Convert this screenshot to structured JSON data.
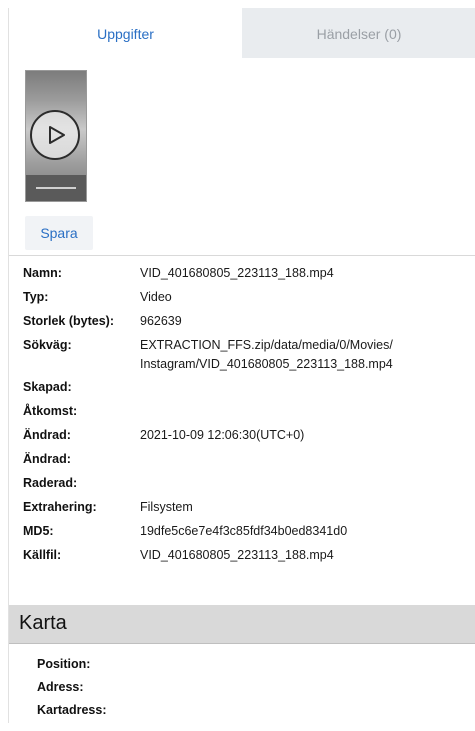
{
  "tabs": [
    {
      "label": "Uppgifter",
      "active": true
    },
    {
      "label": "Händelser (0)",
      "active": false
    }
  ],
  "thumbnail": {
    "icon": "play-icon"
  },
  "actions": {
    "save_label": "Spara"
  },
  "properties": [
    {
      "key": "Namn:",
      "value": "VID_401680805_223113_188.mp4"
    },
    {
      "key": "Typ:",
      "value": "Video"
    },
    {
      "key": "Storlek (bytes):",
      "value": "962639"
    },
    {
      "key": "Sökväg:",
      "value": "EXTRACTION_FFS.zip/data/media/0/Movies/",
      "value2": "Instagram/VID_401680805_223113_188.mp4"
    },
    {
      "key": "Skapad:",
      "value": ""
    },
    {
      "key": "Åtkomst:",
      "value": ""
    },
    {
      "key": "Ändrad:",
      "value": "2021-10-09 12:06:30(UTC+0)"
    },
    {
      "key": "Ändrad:",
      "value": ""
    },
    {
      "key": "Raderad:",
      "value": ""
    },
    {
      "key": "Extrahering:",
      "value": "Filsystem"
    },
    {
      "key": "MD5:",
      "value": "19dfe5c6e7e4f3c85fdf34b0ed8341d0"
    },
    {
      "key": "Källfil:",
      "value": "VID_401680805_223113_188.mp4"
    }
  ],
  "map": {
    "title": "Karta",
    "fields": [
      "Position:",
      "Adress:",
      "Kartadress:"
    ]
  },
  "colors": {
    "accent": "#2a6fc4",
    "header_bg": "#d9d9d9",
    "inactive_tab_bg": "#e9ecef"
  }
}
